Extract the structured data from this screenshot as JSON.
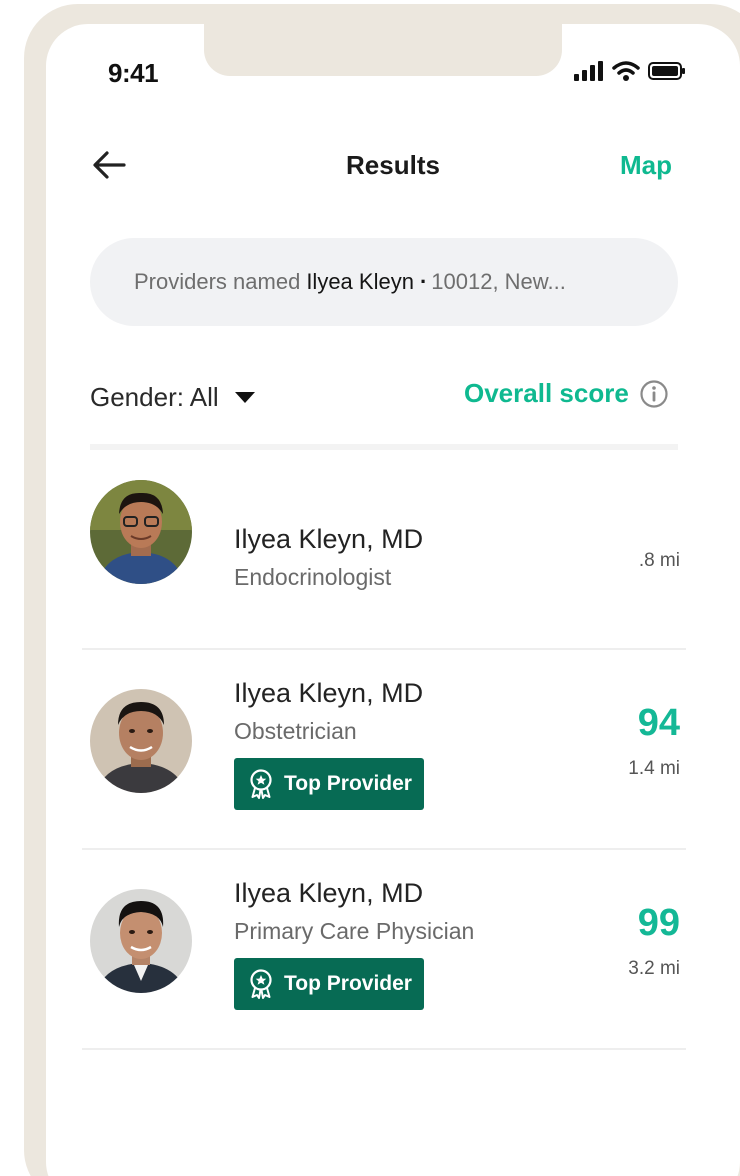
{
  "status_bar": {
    "time": "9:41",
    "icons": [
      "signal-icon",
      "wifi-icon",
      "battery-icon"
    ]
  },
  "header": {
    "title": "Results",
    "back_icon": "arrow-left-icon",
    "map_label": "Map"
  },
  "search": {
    "prefix": "Providers named",
    "query_name": "Ilyea Kleyn",
    "separator": "·",
    "location": "10012, New..."
  },
  "filters": {
    "gender_label": "Gender: All",
    "sort_label": "Overall score"
  },
  "results": [
    {
      "name": "Ilyea Kleyn, MD",
      "specialty": "Endocrinologist",
      "score": "",
      "distance": ".8 mi",
      "badge": ""
    },
    {
      "name": "Ilyea Kleyn, MD",
      "specialty": "Obstetrician",
      "score": "94",
      "distance": "1.4 mi",
      "badge": "Top Provider"
    },
    {
      "name": "Ilyea Kleyn, MD",
      "specialty": "Primary Care Physician",
      "score": "99",
      "distance": "3.2 mi",
      "badge": "Top Provider"
    }
  ],
  "colors": {
    "accent": "#0fb990",
    "badge_bg": "#076b54",
    "frame": "#ece7de",
    "search_bg": "#f1f2f4"
  }
}
